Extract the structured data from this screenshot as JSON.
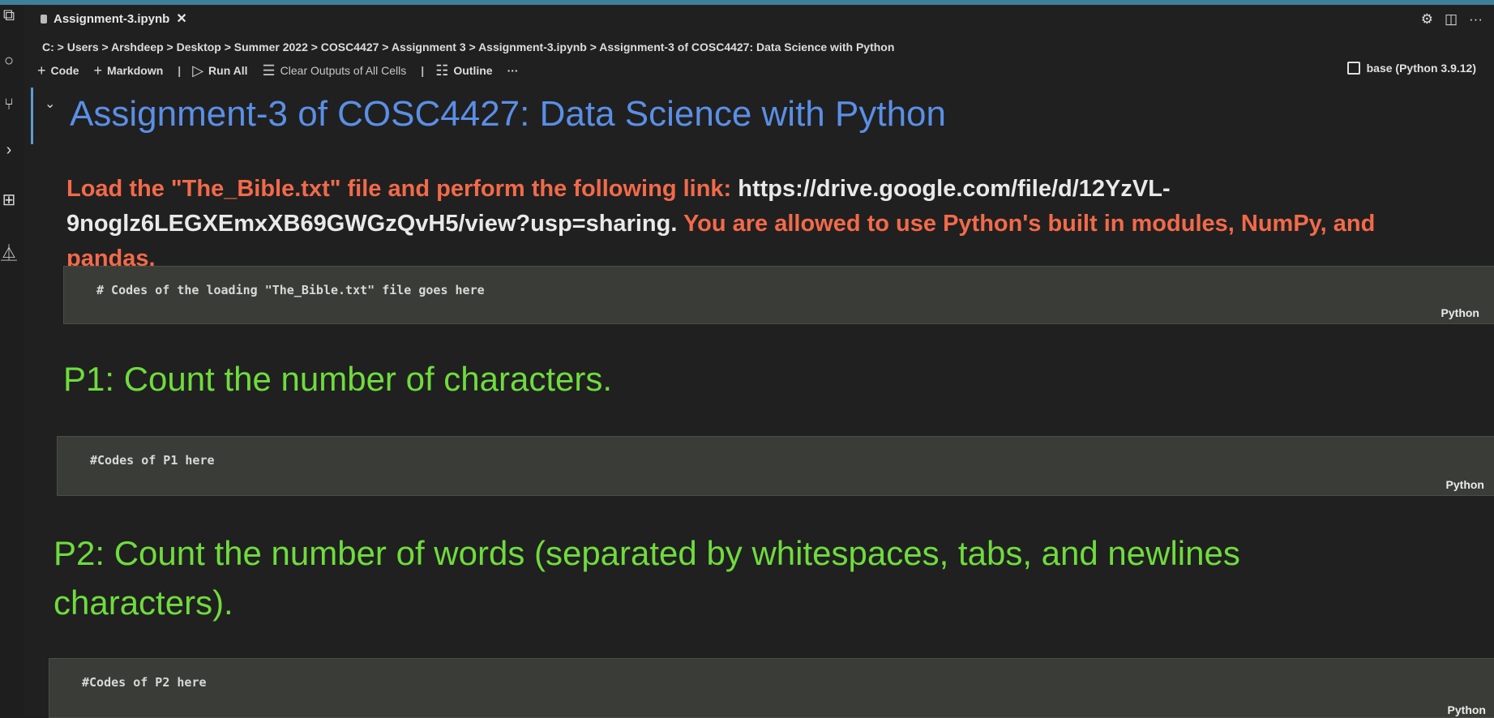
{
  "tab": {
    "title": "Assignment-3.ipynb",
    "close": "✕"
  },
  "breadcrumb": "C: > Users > Arshdeep > Desktop > Summer 2022 > COSC4427 > Assignment 3 > Assignment-3.ipynb > Assignment-3 of COSC4427: Data Science with Python",
  "toolbar": {
    "code": "Code",
    "markdown": "Markdown",
    "run_all": "Run All",
    "clear_outputs": "Clear Outputs of All Cells",
    "outline": "Outline",
    "more": "···"
  },
  "kernel": "base (Python 3.9.12)",
  "notebook": {
    "title": "Assignment-3 of COSC4427: Data Science with Python",
    "intro_prefix": "Load the \"The_Bible.txt\" file and perform the following link: ",
    "intro_link": "https://drive.google.com/file/d/12YzVL-9noglz6LEGXEmxXB69GWGzQvH5/view?usp=sharing.",
    "intro_suffix": " You are allowed to use Python's built in modules, NumPy, and pandas.",
    "code_load": "# Codes of the loading \"The_Bible.txt\" file goes here",
    "p1_heading": "P1: Count the number of characters.",
    "code_p1": "#Codes of P1 here",
    "p2_heading": "P2: Count the number of words (separated by whitespaces, tabs, and newlines characters).",
    "code_p2": "#Codes of P2 here",
    "lang_label": "Python"
  }
}
